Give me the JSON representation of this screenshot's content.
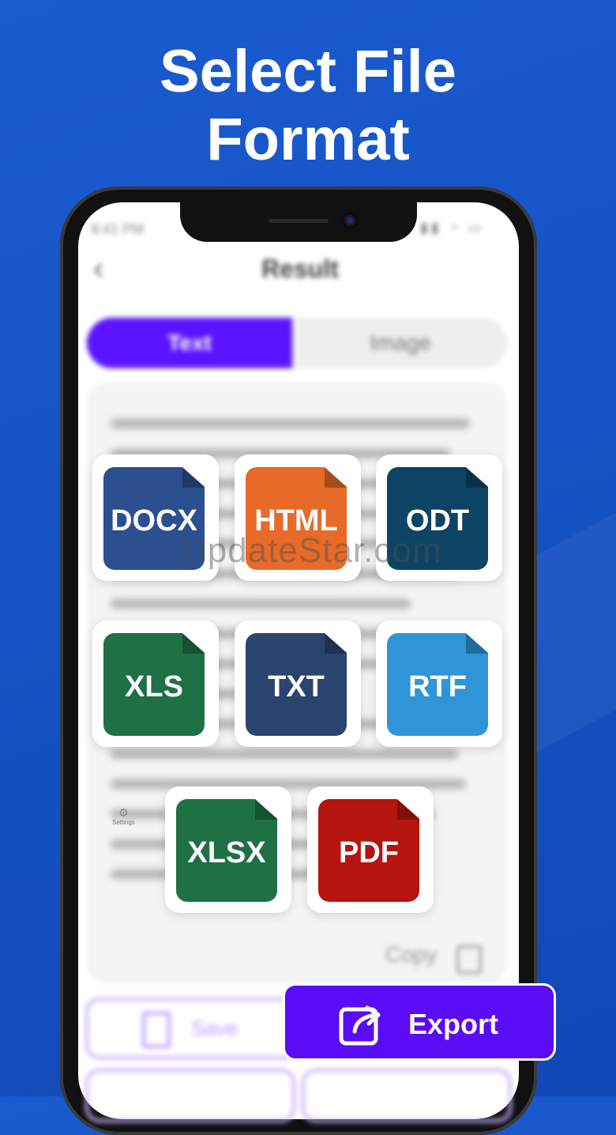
{
  "headline": {
    "line1": "Select File",
    "line2": "Format"
  },
  "status_bar": {
    "time": "9:41 PM",
    "icons": "▮▮ ◔ ▭"
  },
  "app": {
    "back_glyph": "‹",
    "title": "Result",
    "tabs": [
      {
        "label": "Text"
      },
      {
        "label": "Image"
      }
    ],
    "copy_label": "Copy",
    "save_label": "Save",
    "settings_label": "Settings"
  },
  "formats": [
    {
      "label": "DOCX",
      "color": "#2b4f8f"
    },
    {
      "label": "HTML",
      "color": "#e86a28"
    },
    {
      "label": "ODT",
      "color": "#0e4463"
    },
    {
      "label": "XLS",
      "color": "#1f7145"
    },
    {
      "label": "TXT",
      "color": "#2a4470"
    },
    {
      "label": "RTF",
      "color": "#2f95d8"
    },
    {
      "label": "XLSX",
      "color": "#1f7145"
    },
    {
      "label": "PDF",
      "color": "#b5140f"
    }
  ],
  "watermark": "UpdateStar.com",
  "export_label": "Export",
  "colors": {
    "accent": "#5a0cf5",
    "background": "#1553c4"
  }
}
